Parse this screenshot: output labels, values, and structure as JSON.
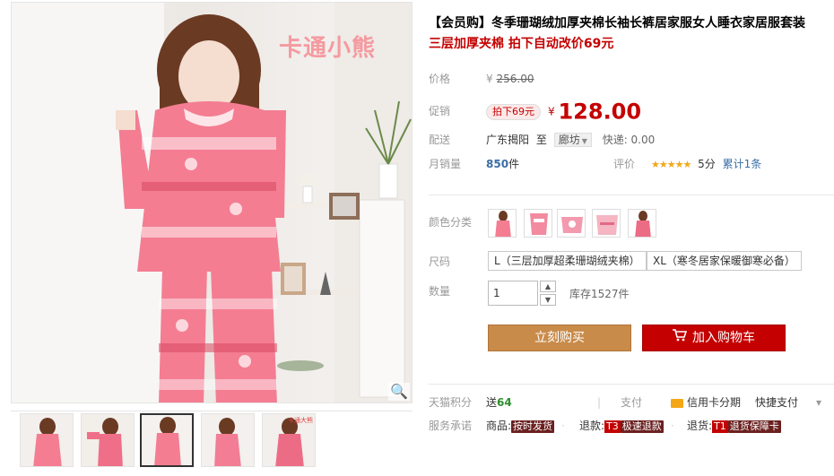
{
  "gallery": {
    "watermark": "卡通小熊",
    "zoom_icon": "magnifier-icon",
    "thumbnail_count": 5,
    "active_thumbnail": 3,
    "thumb5_label": "卡通大熊"
  },
  "product": {
    "title": "【会员购】冬季珊瑚绒加厚夹棉长袖长裤居家服女人睡衣家居服套装",
    "subtitle": "三层加厚夹棉 拍下自动改价69元"
  },
  "price": {
    "label": "价格",
    "currency": "¥",
    "original": "256.00"
  },
  "promo": {
    "label": "促销",
    "badge": "拍下69元",
    "currency": "¥",
    "price": "128.00"
  },
  "shipping": {
    "label": "配送",
    "from": "广东揭阳",
    "to_word": "至",
    "city": "廊坊",
    "express": "快递: 0.00"
  },
  "sales": {
    "label": "月销量",
    "count": "850",
    "unit": "件",
    "rating_label": "评价",
    "stars": "★★★★★",
    "score": "5分",
    "reviews": "累计1条"
  },
  "sku": {
    "color_label": "颜色分类",
    "color_option_count": 5,
    "size_label": "尺码",
    "sizes": [
      "L（三层加厚超柔珊瑚绒夹棉）",
      "XL（寒冬居家保暖御寒必备）"
    ],
    "qty_label": "数量",
    "qty_value": "1",
    "stock": "库存1527件"
  },
  "actions": {
    "buy_now": "立刻购买",
    "add_to_cart": "加入购物车"
  },
  "points": {
    "label": "天猫积分",
    "send_word": "送",
    "value": "64",
    "pay_label": "支付",
    "credit_card": "信用卡分期",
    "quick_pay": "快捷支付",
    "chevron": "▾"
  },
  "service": {
    "label": "服务承诺",
    "goods_label": "商品:",
    "goods_tag": "按时发货",
    "refund_label": "退款:",
    "refund_code": "T3",
    "refund_tag": "极速退款",
    "return_label": "退货:",
    "return_code": "T1",
    "return_tag": "退货保障卡"
  },
  "colors": {
    "accent_red": "#c40000",
    "buy_button": "#c98b4a",
    "pajama_pink": "#f47d92"
  }
}
